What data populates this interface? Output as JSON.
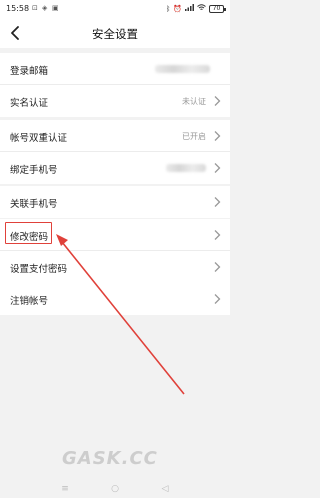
{
  "status_bar": {
    "time": "15:58",
    "battery": "70"
  },
  "header": {
    "title": "安全设置"
  },
  "rows": [
    {
      "label": "登录邮箱",
      "value": ""
    },
    {
      "label": "实名认证",
      "value": "未认证"
    },
    {
      "label": "帐号双重认证",
      "value": "已开启"
    },
    {
      "label": "绑定手机号",
      "value": ""
    },
    {
      "label": "关联手机号",
      "value": ""
    },
    {
      "label": "修改密码",
      "value": ""
    },
    {
      "label": "设置支付密码",
      "value": ""
    },
    {
      "label": "注销帐号",
      "value": ""
    }
  ],
  "watermark": "GASK.CC",
  "colors": {
    "highlight": "#e0413a",
    "background": "#f2f2f2"
  }
}
